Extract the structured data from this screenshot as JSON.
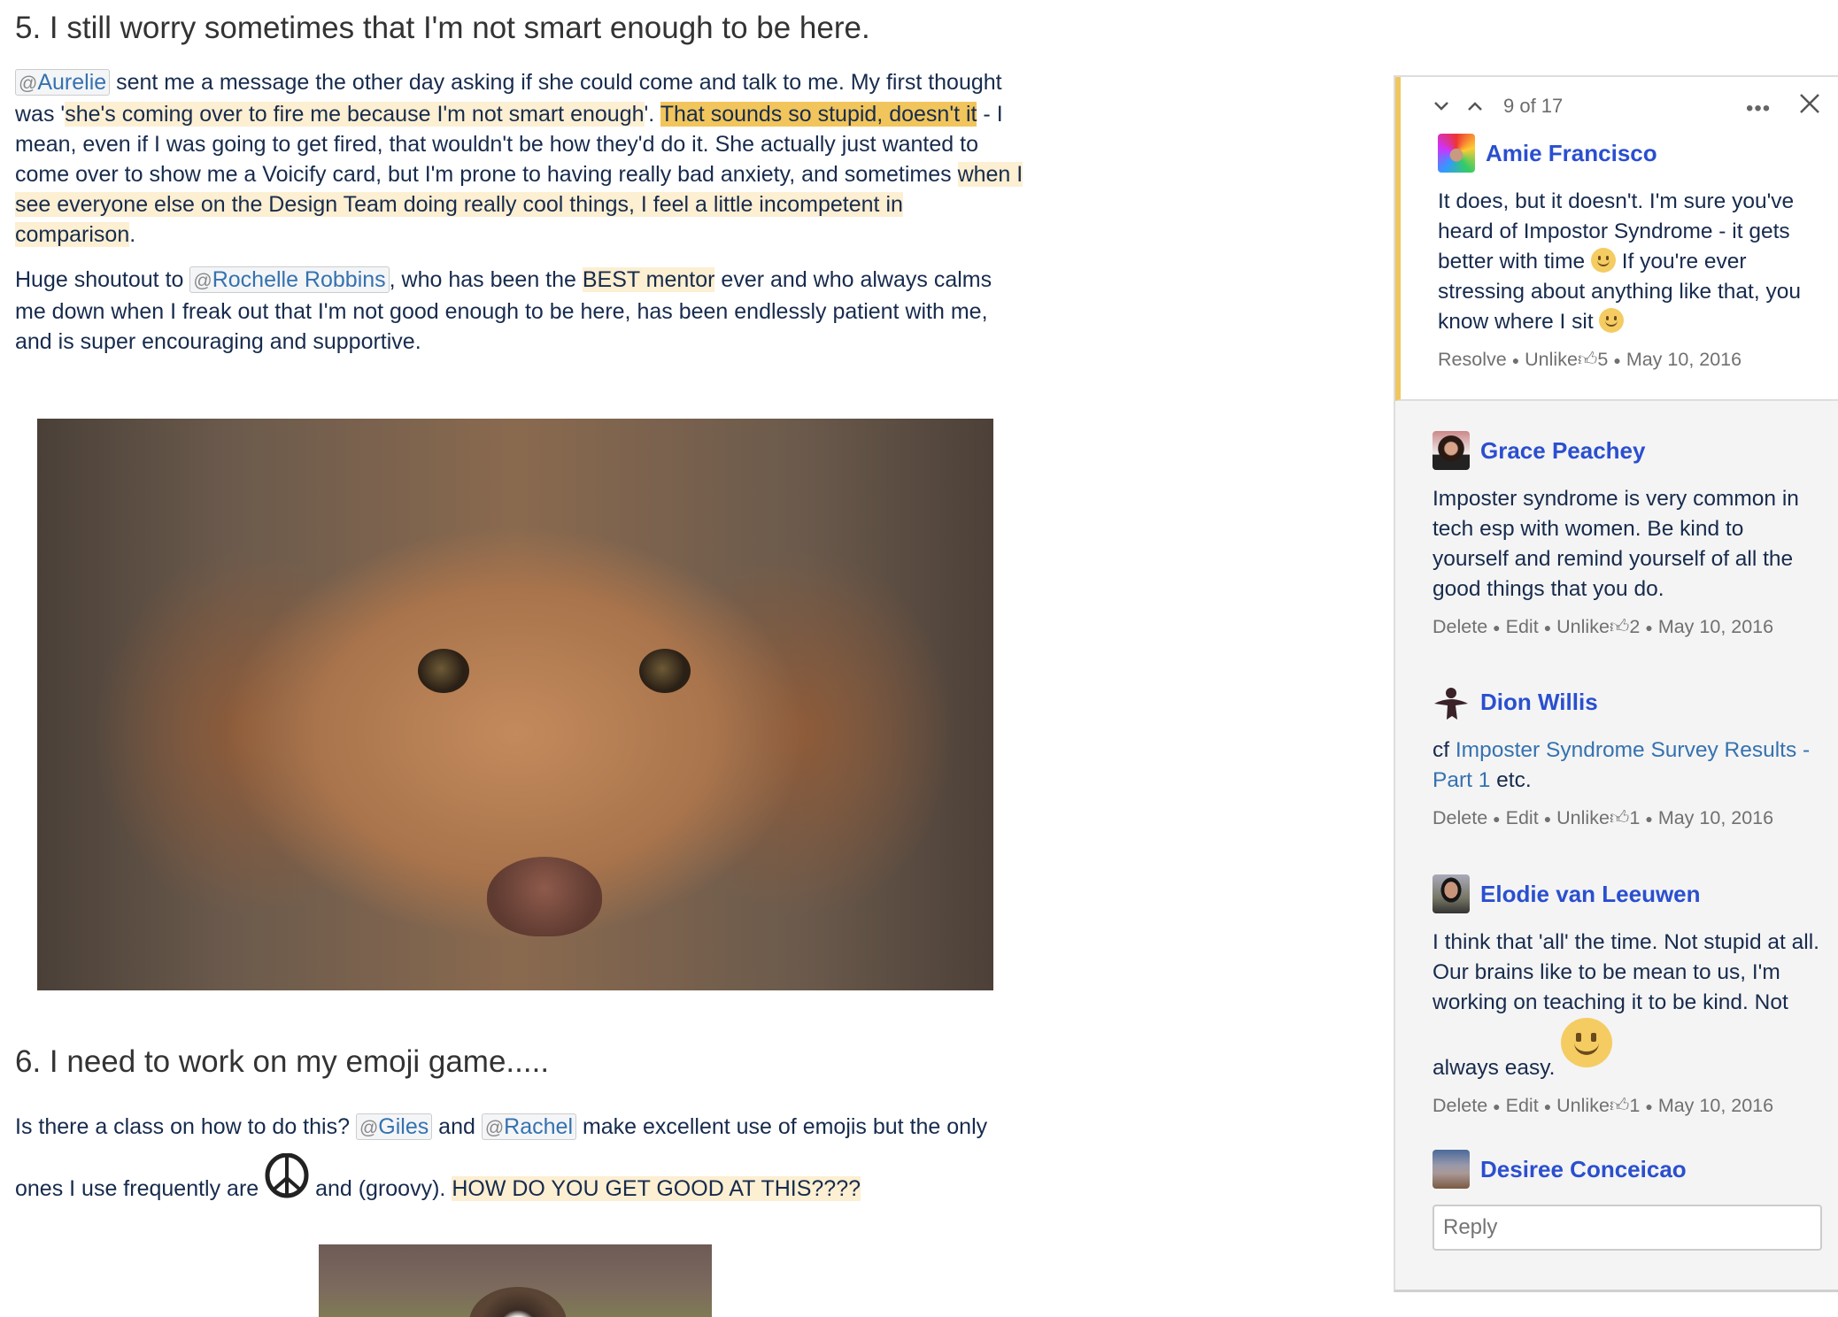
{
  "doc": {
    "h5": "5. I still worry sometimes that I'm not smart enough to be here.",
    "p1": {
      "m1": "Aurelie",
      "t1": " sent me a message the other day asking if she could come and talk to me. My first thought was '",
      "h1": "she's coming over to fire me because I'm not smart enough",
      "t2": "'. ",
      "h2": "That sounds so stupid, doesn't it",
      "t3": " - I mean, even if I was going to get fired, that wouldn't be how they'd do it. She actually just wanted to come over to show me a Voicify card, but I'm prone to having really bad anxiety, and sometimes ",
      "h3": "when I see everyone else on the Design Team doing really cool things, I feel a little incompetent in comparison",
      "t4": "."
    },
    "p2": {
      "t1": "Huge shoutout to ",
      "m1": "Rochelle Robbins",
      "t2": ", who has been the ",
      "h1": "BEST mentor",
      "t3": " ever and who always calms me down when I freak out that I'm not good enough to be here, has been endlessly patient with me, and is super encouraging and supportive."
    },
    "h6": "6. I need to work on my emoji game.....",
    "p3": {
      "t1": "Is there a class on how to do this? ",
      "m1": "Giles",
      "t2": " and ",
      "m2": "Rachel",
      "t3": " make excellent use of emojis but the only ones I use frequently are ",
      "t4": " and (groovy). ",
      "h1": "HOW DO YOU GET GOOD AT THIS????"
    },
    "at": "@"
  },
  "panel": {
    "counter": "9 of 17",
    "more": "•••",
    "colors": {
      "accent": "#f0c75e",
      "name": "#2a4fcf",
      "link": "#3572b0"
    },
    "comments": [
      {
        "author": "Amie Francisco",
        "b1": "It does, but it doesn't. I'm sure you've heard of Impostor Syndrome - it gets better with time ",
        "b2": " If you're ever stressing about anything like that, you know where I sit ",
        "actions": [
          "Resolve",
          "Unlike"
        ],
        "likes": "5",
        "date": "May 10, 2016"
      },
      {
        "author": "Grace Peachey",
        "b1": "Imposter syndrome is very common in tech esp with women. Be kind to yourself and remind yourself of all the good things that you do.",
        "actions": [
          "Delete",
          "Edit",
          "Unlike"
        ],
        "likes": "2",
        "date": "May 10, 2016"
      },
      {
        "author": "Dion Willis",
        "b1": "cf ",
        "link": "Imposter Syndrome Survey Results - Part 1",
        "b2": " etc.",
        "actions": [
          "Delete",
          "Edit",
          "Unlike"
        ],
        "likes": "1",
        "date": "May 10, 2016"
      },
      {
        "author": "Elodie van Leeuwen",
        "b1": "I think that 'all' the time. Not stupid at all. Our brains like to be mean to us, I'm working on teaching it to be kind. Not always easy. ",
        "actions": [
          "Delete",
          "Edit",
          "Unlike"
        ],
        "likes": "1",
        "date": "May 10, 2016"
      }
    ],
    "reply_author": "Desiree Conceicao",
    "reply_placeholder": "Reply"
  }
}
